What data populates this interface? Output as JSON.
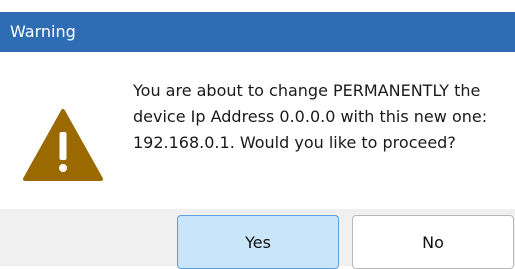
{
  "dialog": {
    "title": "Warning",
    "icon": "warning-icon",
    "message": "You are about to change PERMANENTLY the device Ip Address 0.0.0.0 with this new one: 192.168.0.1. Would you like to proceed?",
    "buttons": {
      "yes_label": "Yes",
      "no_label": "No"
    }
  },
  "colors": {
    "titlebar": "#2e6db4",
    "warning_icon": "#9a6a00",
    "yes_button_bg": "#c8e5fa",
    "yes_button_border": "#5aa0dc",
    "footer_bg": "#f0f0f0"
  }
}
